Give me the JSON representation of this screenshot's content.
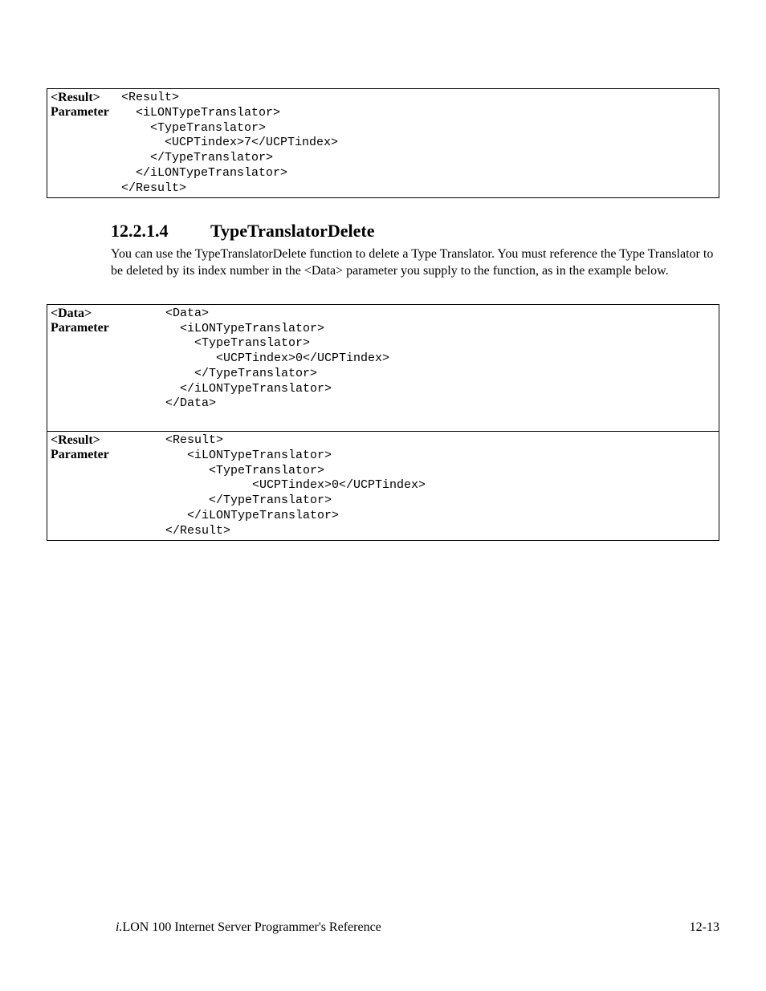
{
  "table1": {
    "label_line1": "<Result>",
    "label_line2": "Parameter",
    "code": "<Result>\n  <iLONTypeTranslator>\n    <TypeTranslator>\n      <UCPTindex>7</UCPTindex>\n    </TypeTranslator>\n  </iLONTypeTranslator>\n</Result>"
  },
  "heading": {
    "number": "12.2.1.4",
    "title": "TypeTranslatorDelete"
  },
  "paragraph": "You can use the TypeTranslatorDelete function to delete a Type Translator. You must reference the Type Translator to be deleted by its index number in the <Data> parameter you supply to the function, as in the example below.",
  "table2": {
    "row1": {
      "label_line1": "<Data>",
      "label_line2": "Parameter",
      "code": "<Data>\n  <iLONTypeTranslator>\n    <TypeTranslator>\n       <UCPTindex>0</UCPTindex>\n    </TypeTranslator>\n  </iLONTypeTranslator>\n</Data>"
    },
    "row2": {
      "label_line1": "<Result>",
      "label_line2": "Parameter",
      "code": "<Result>\n   <iLONTypeTranslator>\n      <TypeTranslator>\n            <UCPTindex>0</UCPTindex>\n      </TypeTranslator>\n   </iLONTypeTranslator>\n</Result>"
    }
  },
  "footer": {
    "prefix_italic": "i.",
    "title_rest": "LON 100 Internet Server Programmer's Reference",
    "page_number": "12-13"
  }
}
